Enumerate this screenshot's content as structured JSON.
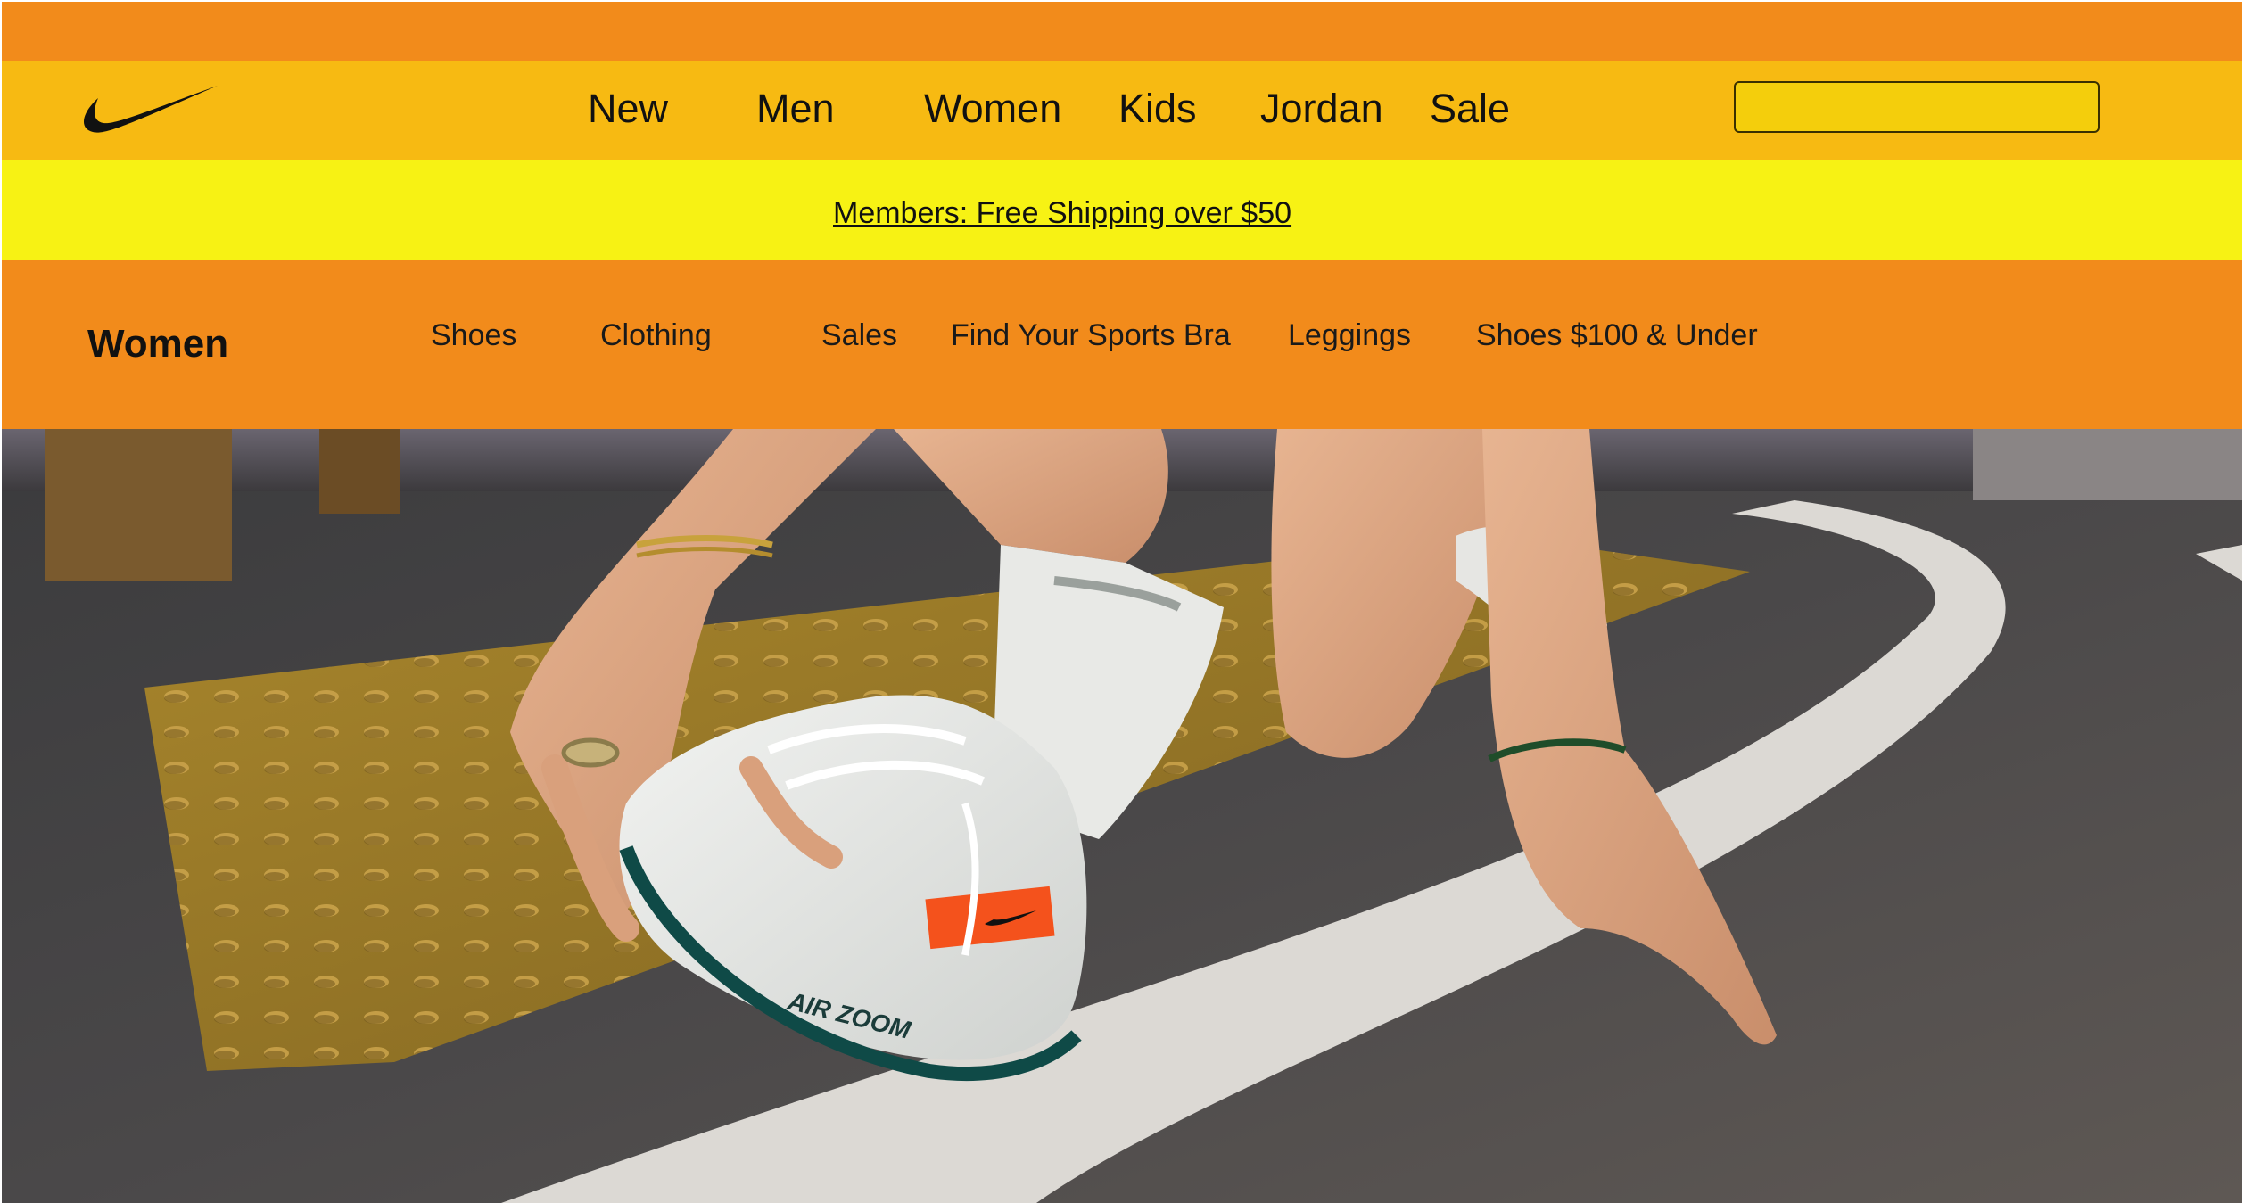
{
  "brand": {
    "logo_icon": "swoosh-logo-icon",
    "colors": {
      "top_strip": "#f28b1b",
      "nav_bar": "#f7ba12",
      "promo_bar": "#f7f214",
      "sub_nav": "#f28b1b",
      "search_fill": "#f4ce0c"
    }
  },
  "main_nav": {
    "items": [
      {
        "label": "New"
      },
      {
        "label": "Men"
      },
      {
        "label": "Women"
      },
      {
        "label": "Kids"
      },
      {
        "label": "Jordan"
      },
      {
        "label": "Sale"
      }
    ]
  },
  "search": {
    "value": "",
    "placeholder": ""
  },
  "promo": {
    "text": "Members: Free Shipping over $50"
  },
  "sub_nav": {
    "title": "Women",
    "items": [
      {
        "label": "Shoes"
      },
      {
        "label": "Clothing"
      },
      {
        "label": "Sales"
      },
      {
        "label": "Find Your Sports Bra"
      },
      {
        "label": "Leggings"
      },
      {
        "label": "Shoes $100 &  Under"
      }
    ]
  },
  "hero": {
    "image_icon": "hero-image",
    "shoe_branding": "AIR ZOOM"
  }
}
